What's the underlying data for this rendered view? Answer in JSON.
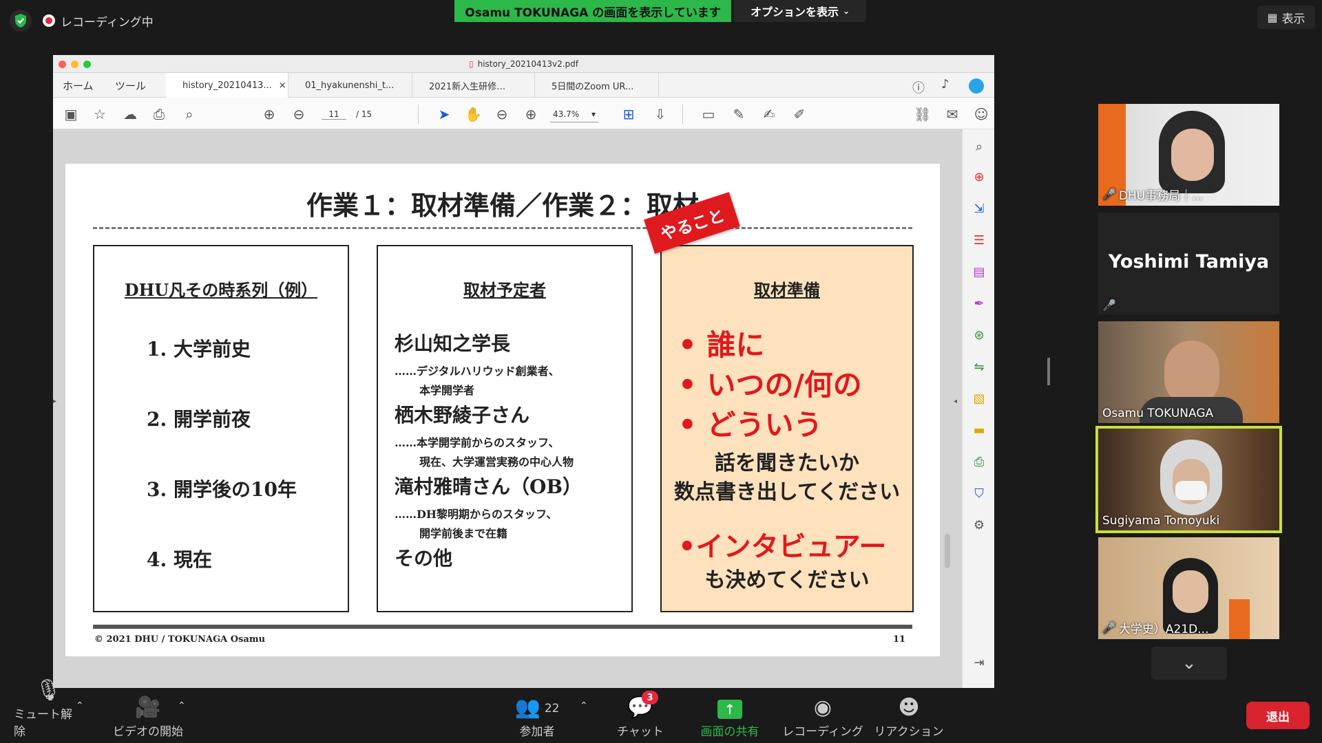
{
  "zoom": {
    "recording_label": "レコーディング中",
    "share_banner": "Osamu TOKUNAGA の画面を表示しています",
    "options_label": "オプションを表示",
    "view_label": "表示",
    "toolbar": {
      "mute": "ミュート解除",
      "video": "ビデオの開始",
      "participants": "参加者",
      "participants_count": "22",
      "chat": "チャット",
      "chat_badge": "3",
      "share": "画面の共有",
      "record": "レコーディング",
      "reaction": "リアクション",
      "leave": "退出"
    },
    "participants": [
      {
        "name": "DHU事務局｜..."
      },
      {
        "name": "Yoshimi Tamiya"
      },
      {
        "name": "Osamu TOKUNAGA"
      },
      {
        "name": "Sugiyama Tomoyuki"
      },
      {
        "name": "大学史）A21D..."
      }
    ]
  },
  "acrobat": {
    "window_title": "history_20210413v2.pdf",
    "menu": [
      "ホーム",
      "ツール"
    ],
    "tabs": [
      {
        "label": "history_20210413...",
        "close": "×"
      },
      {
        "label": "01_hyakunenshi_t..."
      },
      {
        "label": "2021新入生研修…"
      },
      {
        "label": "5日間のZoom UR..."
      }
    ],
    "page_current": "11",
    "page_total": "/ 15",
    "zoom_value": "43.7%"
  },
  "slide": {
    "title": "作業１：取材準備／作業２：取材",
    "badge": "やること",
    "col1": {
      "title": "DHU凡その時系列（例）",
      "items": [
        "1. 大学前史",
        "2. 開学前夜",
        "3. 開学後の10年",
        "4. 現在"
      ]
    },
    "col2": {
      "title": "取材予定者",
      "p1_name": "杉山知之学長",
      "p1_desc1": "……デジタルハリウッド創業者、",
      "p1_desc2": "本学開学者",
      "p2_name": "栖木野綾子さん",
      "p2_desc1": "……本学開学前からのスタッフ、",
      "p2_desc2": "現在、大学運営実務の中心人物",
      "p3_name": "滝村雅晴さん（OB）",
      "p3_desc1": "……DH黎明期からのスタッフ、",
      "p3_desc2": "開学前後まで在籍",
      "other": "その他"
    },
    "col3": {
      "title": "取材準備",
      "b1": "• 誰に",
      "b2": "• いつの/何の",
      "b3": "• どういう",
      "t1": "話を聞きたいか",
      "t2": "数点書き出してください",
      "b4": "•インタビュアー",
      "t3": "も決めてください"
    },
    "footer_left": "© 2021 DHU / TOKUNAGA Osamu",
    "footer_right": "11"
  },
  "colors": {
    "share_green": "#2db84a",
    "leave_red": "#d9232e",
    "slide_red": "#e0191e",
    "highlight_box": "#fde2bd",
    "active_speaker": "#c8e03a"
  }
}
